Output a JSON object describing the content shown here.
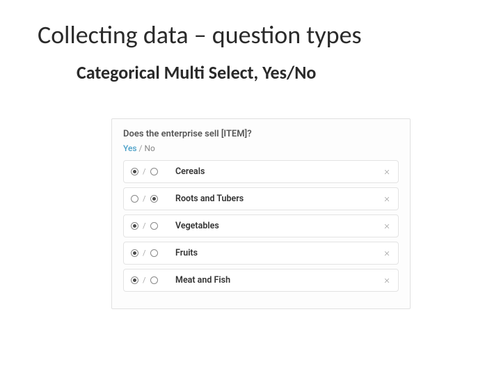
{
  "slide": {
    "title": "Collecting data – question types",
    "subtitle": "Categorical Multi Select, Yes/No"
  },
  "question": {
    "text": "Does the enterprise sell [ITEM]?",
    "yes_label": "Yes",
    "no_label": "No"
  },
  "options": [
    {
      "label": "Cereals",
      "yes": true,
      "no": false
    },
    {
      "label": "Roots and Tubers",
      "yes": false,
      "no": true
    },
    {
      "label": "Vegetables",
      "yes": true,
      "no": false
    },
    {
      "label": "Fruits",
      "yes": true,
      "no": false
    },
    {
      "label": "Meat and Fish",
      "yes": true,
      "no": false
    }
  ]
}
